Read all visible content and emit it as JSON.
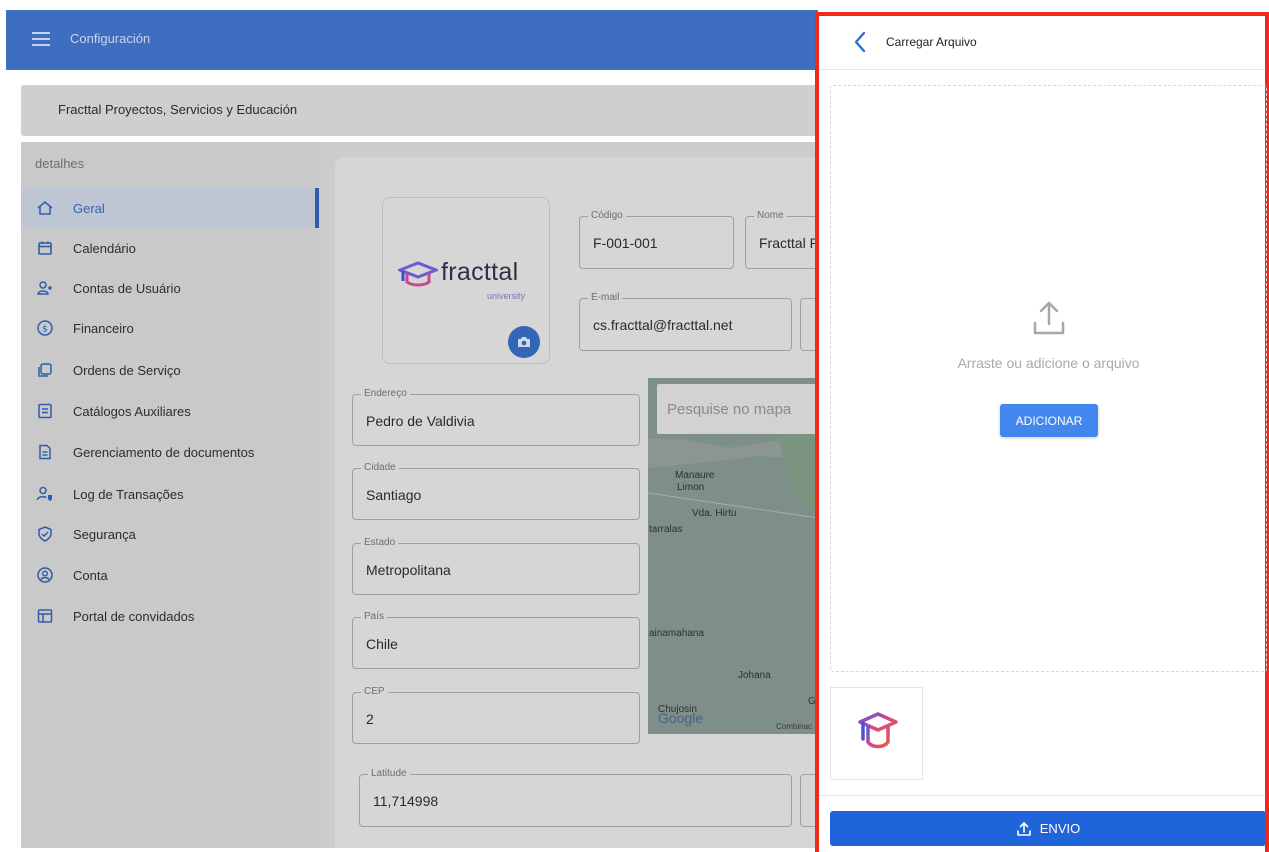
{
  "header": {
    "title": "Configuración"
  },
  "organization": {
    "name": "Fracttal Proyectos, Servicios y Educación"
  },
  "sidebar": {
    "heading": "detalhes",
    "items": [
      {
        "label": "Geral",
        "icon": "home-icon",
        "active": true
      },
      {
        "label": "Calendário",
        "icon": "calendar-icon"
      },
      {
        "label": "Contas de Usuário",
        "icon": "add-user-icon"
      },
      {
        "label": "Financeiro",
        "icon": "dollar-icon"
      },
      {
        "label": "Ordens de Serviço",
        "icon": "copy-icon"
      },
      {
        "label": "Catálogos Auxiliares",
        "icon": "catalog-icon"
      },
      {
        "label": "Gerenciamento de documentos",
        "icon": "document-icon"
      },
      {
        "label": "Log de Transações",
        "icon": "user-shield-icon"
      },
      {
        "label": "Segurança",
        "icon": "shield-check-icon"
      },
      {
        "label": "Conta",
        "icon": "account-icon"
      },
      {
        "label": "Portal de convidados",
        "icon": "layout-icon"
      }
    ]
  },
  "logo": {
    "word": "fracttal",
    "sub": "university"
  },
  "form": {
    "codigo": {
      "label": "Código",
      "value": "F-001-001"
    },
    "nome": {
      "label": "Nome",
      "value": "Fracttal P"
    },
    "email": {
      "label": "E-mail",
      "value": "cs.fracttal@fracttal.net"
    },
    "endereco": {
      "label": "Endereço",
      "value": "Pedro de Valdivia"
    },
    "cidade": {
      "label": "Cidade",
      "value": "Santiago"
    },
    "estado": {
      "label": "Estado",
      "value": "Metropolitana"
    },
    "pais": {
      "label": "País",
      "value": "Chile"
    },
    "cep": {
      "label": "CEP",
      "value": "2"
    },
    "latitude": {
      "label": "Latitude",
      "value": "11,714998"
    }
  },
  "map": {
    "search_placeholder": "Pesquise no mapa",
    "labels": [
      "Manaure",
      "Limon",
      "Vda. Hirtu",
      "tarralas",
      "ainamahana",
      "Johana",
      "Chujosin",
      "G"
    ],
    "google": "Google",
    "combi": "Combinac"
  },
  "panel": {
    "title": "Carregar Arquivo",
    "drop_text": "Arraste ou adicione o arquivo",
    "add_label": "ADICIONAR",
    "send_label": "ENVIO"
  },
  "colors": {
    "accent": "#1f64d9",
    "add_button": "#4287ee",
    "highlight_border": "#ee2a1b",
    "topbar": "#3f6ec1"
  }
}
